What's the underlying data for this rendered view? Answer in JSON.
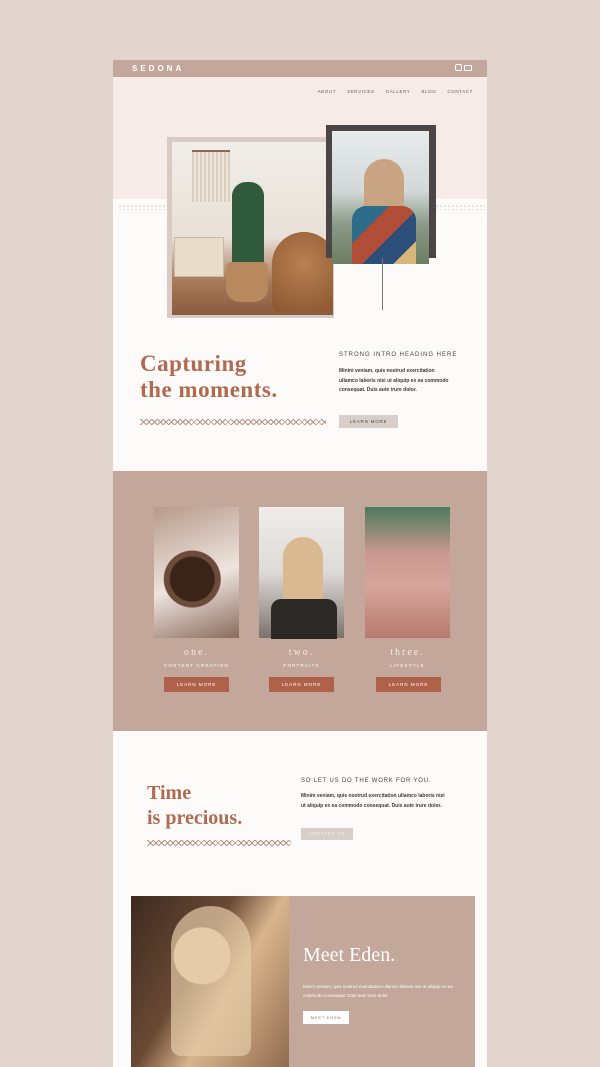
{
  "brand": {
    "logo": "SEDONA"
  },
  "nav": {
    "items": [
      "ABOUT",
      "SERVICES",
      "GALLERY",
      "BLOG",
      "CONTACT"
    ]
  },
  "intro": {
    "title_line1": "Capturing",
    "title_line2": "the moments.",
    "heading": "STRONG INTRO HEADING HERE",
    "body": "Minim veniam, quis nostrud exercitation ullamco laboris nisi ut aliquip ex ea commodo consequat. Duis aute irure dolor.",
    "button": "LEARN MORE"
  },
  "services": [
    {
      "number": "one.",
      "label": "CONTENT CREATION",
      "button": "LEARN MORE"
    },
    {
      "number": "two.",
      "label": "PORTRAITS",
      "button": "LEARN MORE"
    },
    {
      "number": "three.",
      "label": "LIFESTYLE",
      "button": "LEARN MORE"
    }
  ],
  "time": {
    "title_line1": "Time",
    "title_line2": "is precious.",
    "heading": "SO LET US DO THE WORK FOR YOU.",
    "body": "Minim veniam, quis nostrud exercitation ullamco laboris nisi ut aliquip ex ea commodo consequat. Duis aute irure dolor.",
    "button": "CONTACT US"
  },
  "eden": {
    "title": "Meet Eden.",
    "body": "Minim veniam, quis nostrud exercitation ullamco laboris nisi ut aliquip ex ea commodo consequat. Duis aute irure dolor.",
    "button": "MEET EDEN"
  },
  "colors": {
    "background": "#e2d5cd",
    "accent": "#c3a79a",
    "heading": "#b06a4e",
    "button": "#b0614a"
  },
  "icons": [
    "instagram-icon",
    "mail-icon"
  ]
}
